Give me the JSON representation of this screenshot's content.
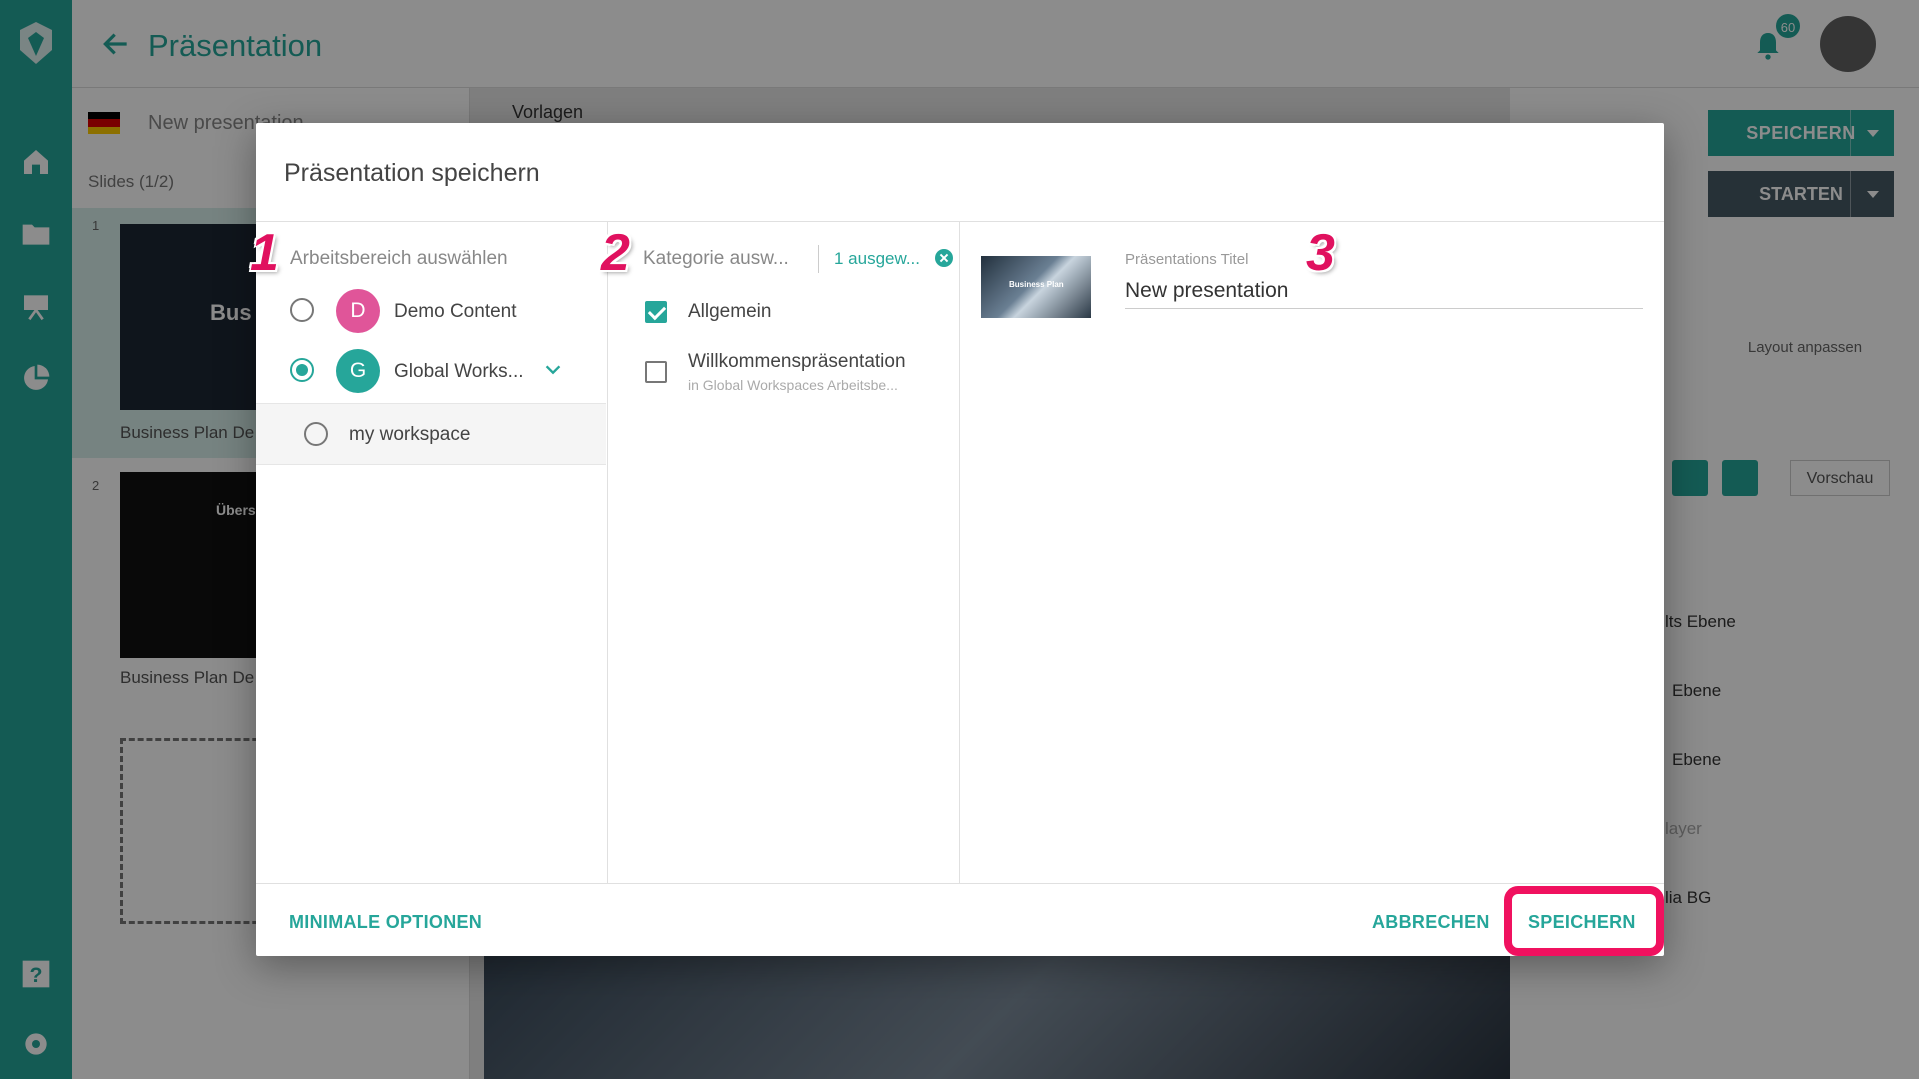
{
  "app": {
    "title": "Präsentation",
    "notification_count": "60",
    "colors": {
      "accent": "#26a69a",
      "highlight": "#f0115f",
      "step_number": "#e0115f"
    }
  },
  "left_panel": {
    "presentation_name": "New presentation",
    "slides_count": "Slides (1/2)",
    "slides": [
      {
        "number": "1",
        "thumb_text": "Bus",
        "caption": "Business Plan De"
      },
      {
        "number": "2",
        "thumb_text": "Übers",
        "caption": "Business Plan De"
      }
    ]
  },
  "center_panel": {
    "tab_label": "Vorlagen"
  },
  "right_panel": {
    "save_label": "SPEICHERN",
    "start_label": "STARTEN",
    "layout_label": "Layout anpassen",
    "preview_label": "Vorschau",
    "layers": [
      "lts Ebene",
      "Ebene",
      "Ebene",
      "layer",
      "lia BG"
    ]
  },
  "dialog": {
    "title": "Präsentation speichern",
    "steps": [
      "1",
      "2",
      "3"
    ],
    "workspace": {
      "heading": "Arbeitsbereich auswählen",
      "items": [
        {
          "initial": "D",
          "name": "Demo Content",
          "color": "#e05599",
          "selected": false
        },
        {
          "initial": "G",
          "name": "Global Works...",
          "color": "#26a69a",
          "selected": true
        }
      ],
      "sub_item": "my workspace"
    },
    "category": {
      "heading": "Kategorie ausw...",
      "selected_count": "1 ausgew...",
      "items": [
        {
          "name": "Allgemein",
          "sub": "",
          "checked": true
        },
        {
          "name": "Willkommenspräsentation",
          "sub": "in Global Workspaces Arbeitsbe...",
          "checked": false
        }
      ]
    },
    "details": {
      "thumb_text": "Business Plan",
      "title_label": "Präsentations Titel",
      "title_value": "New presentation"
    },
    "footer": {
      "minimal_options": "MINIMALE OPTIONEN",
      "cancel": "ABBRECHEN",
      "save": "SPEICHERN"
    }
  }
}
